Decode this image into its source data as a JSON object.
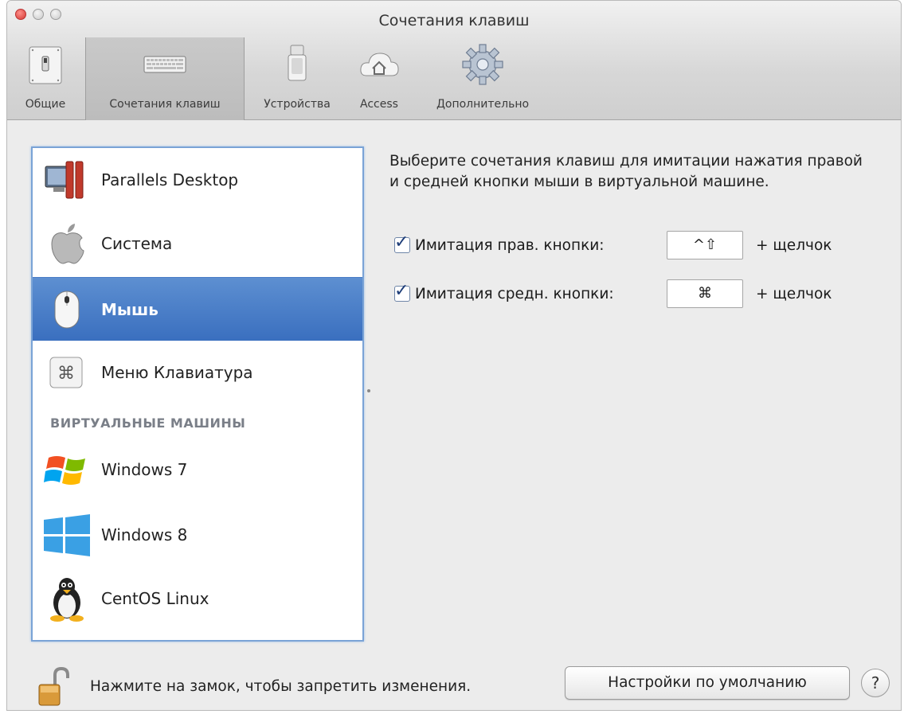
{
  "window": {
    "title": "Сочетания клавиш"
  },
  "toolbar": {
    "items": [
      {
        "label": "Общие",
        "icon": "general-switch-icon",
        "selected": false
      },
      {
        "label": "Сочетания клавиш",
        "icon": "keyboard-icon",
        "selected": true
      },
      {
        "label": "Устройства",
        "icon": "usb-device-icon",
        "selected": false
      },
      {
        "label": "Access",
        "icon": "cloud-home-icon",
        "selected": false
      },
      {
        "label": "Дополнительно",
        "icon": "gear-icon",
        "selected": false
      }
    ]
  },
  "sidebar": {
    "items": [
      {
        "label": "Parallels Desktop",
        "icon": "parallels-icon"
      },
      {
        "label": "Система",
        "icon": "apple-icon"
      },
      {
        "label": "Мышь",
        "icon": "mouse-icon",
        "selected": true
      },
      {
        "label": "Меню Клавиатура",
        "icon": "command-key-icon"
      }
    ],
    "section_header": "ВИРТУАЛЬНЫЕ МАШИНЫ",
    "vms": [
      {
        "label": "Windows 7",
        "icon": "windows7-icon"
      },
      {
        "label": "Windows 8",
        "icon": "windows8-icon"
      },
      {
        "label": "CentOS Linux",
        "icon": "linux-tux-icon"
      }
    ]
  },
  "main": {
    "description": "Выберите сочетания клавиш для имитации нажатия правой и средней кнопки мыши в виртуальной машине.",
    "right_click": {
      "label": "Имитация прав. кнопки:",
      "checked": true,
      "keys": "^⇧",
      "suffix": "+ щелчок"
    },
    "middle_click": {
      "label": "Имитация средн. кнопки:",
      "checked": true,
      "keys": "⌘",
      "suffix": "+ щелчок"
    }
  },
  "footer": {
    "lock_text": "Нажмите на замок, чтобы запретить изменения.",
    "defaults_button": "Настройки по умолчанию",
    "help_button": "?"
  },
  "colors": {
    "selection": "#3a6fbf",
    "list_border": "#7aa3d6",
    "window_bg": "#ececec"
  }
}
